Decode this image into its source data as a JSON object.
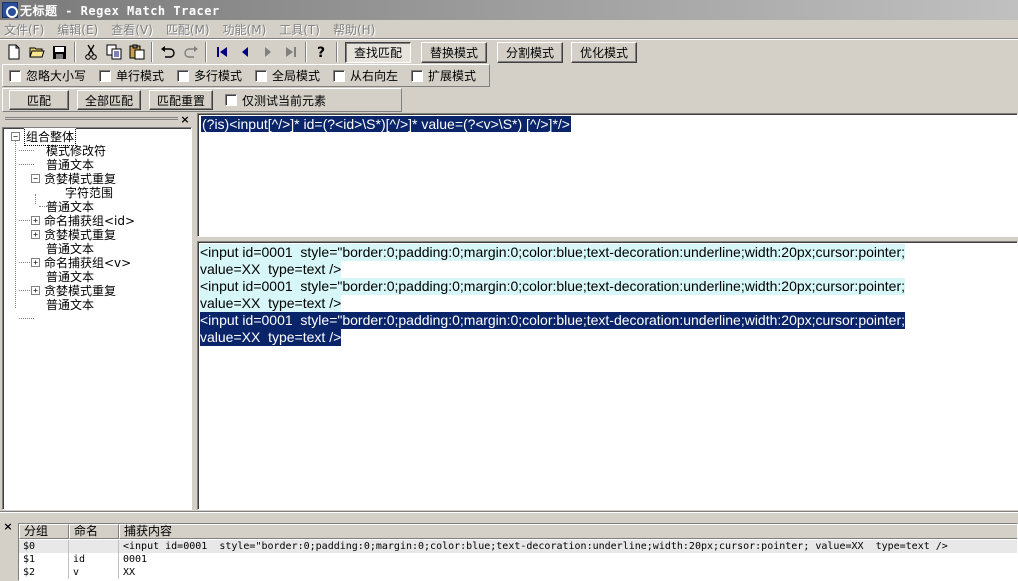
{
  "window": {
    "title": "无标题 - Regex Match Tracer"
  },
  "menu": [
    "文件(F)",
    "编辑(E)",
    "查看(V)",
    "匹配(M)",
    "功能(M)",
    "工具(T)",
    "帮助(H)"
  ],
  "toolbar": {
    "modes": [
      "查找匹配",
      "替换模式",
      "分割模式",
      "优化模式"
    ]
  },
  "options": [
    "忽略大小写",
    "单行模式",
    "多行模式",
    "全局模式",
    "从右向左",
    "扩展模式"
  ],
  "actions": {
    "match": "匹配",
    "match_all": "全部匹配",
    "reset": "匹配重置",
    "test_current": "仅测试当前元素"
  },
  "tree": {
    "root": "组合整体",
    "items": [
      {
        "label": "模式修改符"
      },
      {
        "label": "普通文本"
      },
      {
        "label": "贪婪模式重复"
      },
      {
        "label": "字符范围"
      },
      {
        "label": "普通文本"
      },
      {
        "label": "命名捕获组<id>"
      },
      {
        "label": "贪婪模式重复"
      },
      {
        "label": "普通文本"
      },
      {
        "label": "命名捕获组<v>"
      },
      {
        "label": "普通文本"
      },
      {
        "label": "贪婪模式重复"
      },
      {
        "label": "普通文本"
      }
    ]
  },
  "pattern": "(?is)<input[^/>]* id=(?<id>\\S*)[^/>]* value=(?<v>\\S*) [^/>]*/>",
  "subject": {
    "lines": [
      "<input id=0001  style=\"border:0;padding:0;margin:0;color:blue;text-decoration:underline;width:20px;cursor:pointer;",
      "value=XX  type=text />",
      "<input id=0001  style=\"border:0;padding:0;margin:0;color:blue;text-decoration:underline;width:20px;cursor:pointer;",
      "value=XX  type=text />",
      "<input id=0001  style=\"border:0;padding:0;margin:0;color:blue;text-decoration:underline;width:20px;cursor:pointer;",
      "value=XX  type=text />"
    ]
  },
  "results": {
    "headers": [
      "分组",
      "命名",
      "捕获内容"
    ],
    "rows": [
      [
        "$0",
        "",
        "<input id=0001  style=\"border:0;padding:0;margin:0;color:blue;text-decoration:underline;width:20px;cursor:pointer; value=XX  type=text />"
      ],
      [
        "$1",
        "id",
        "0001"
      ],
      [
        "$2",
        "v",
        "XX"
      ]
    ]
  },
  "colors": {
    "selection": "#0a246a",
    "match_highlight": "#d7f6f8",
    "face": "#d4d0c8"
  }
}
